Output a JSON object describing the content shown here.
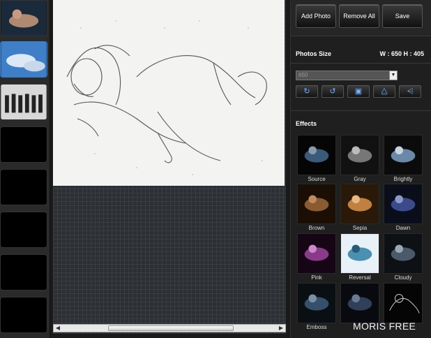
{
  "toolbar": {
    "add_photo": "Add Photo",
    "remove_all": "Remove All",
    "save": "Save"
  },
  "photos_size": {
    "title": "Photos Size",
    "readout": "W : 650 H : 405",
    "select_value": "650"
  },
  "tools": [
    {
      "icon": "rotate-right-icon",
      "glyph": "↻"
    },
    {
      "icon": "rotate-left-icon",
      "glyph": "↺"
    },
    {
      "icon": "crop-icon",
      "glyph": "▣"
    },
    {
      "icon": "flip-vertical-icon",
      "glyph": "⧋"
    },
    {
      "icon": "flip-horizontal-icon",
      "glyph": "⩤"
    }
  ],
  "effects": {
    "title": "Effects",
    "items": [
      {
        "label": "Source",
        "tint": "#3a5a7a"
      },
      {
        "label": "Gray",
        "tint": "#777777"
      },
      {
        "label": "Brightly",
        "tint": "#6a88a8"
      },
      {
        "label": "Brown",
        "tint": "#8a5a30"
      },
      {
        "label": "Sepia",
        "tint": "#c08040"
      },
      {
        "label": "Dawn",
        "tint": "#3a4a8a"
      },
      {
        "label": "Pink",
        "tint": "#8a3a8a"
      },
      {
        "label": "Reversal",
        "tint": "#e8f0f8"
      },
      {
        "label": "Cloudy",
        "tint": "#4a5a6a"
      },
      {
        "label": "Emboss",
        "tint": "#34506a"
      },
      {
        "label": "",
        "tint": "#30405a"
      },
      {
        "label": "",
        "tint": "#d0d8e0"
      }
    ]
  },
  "watermark": "MORIS FREE"
}
